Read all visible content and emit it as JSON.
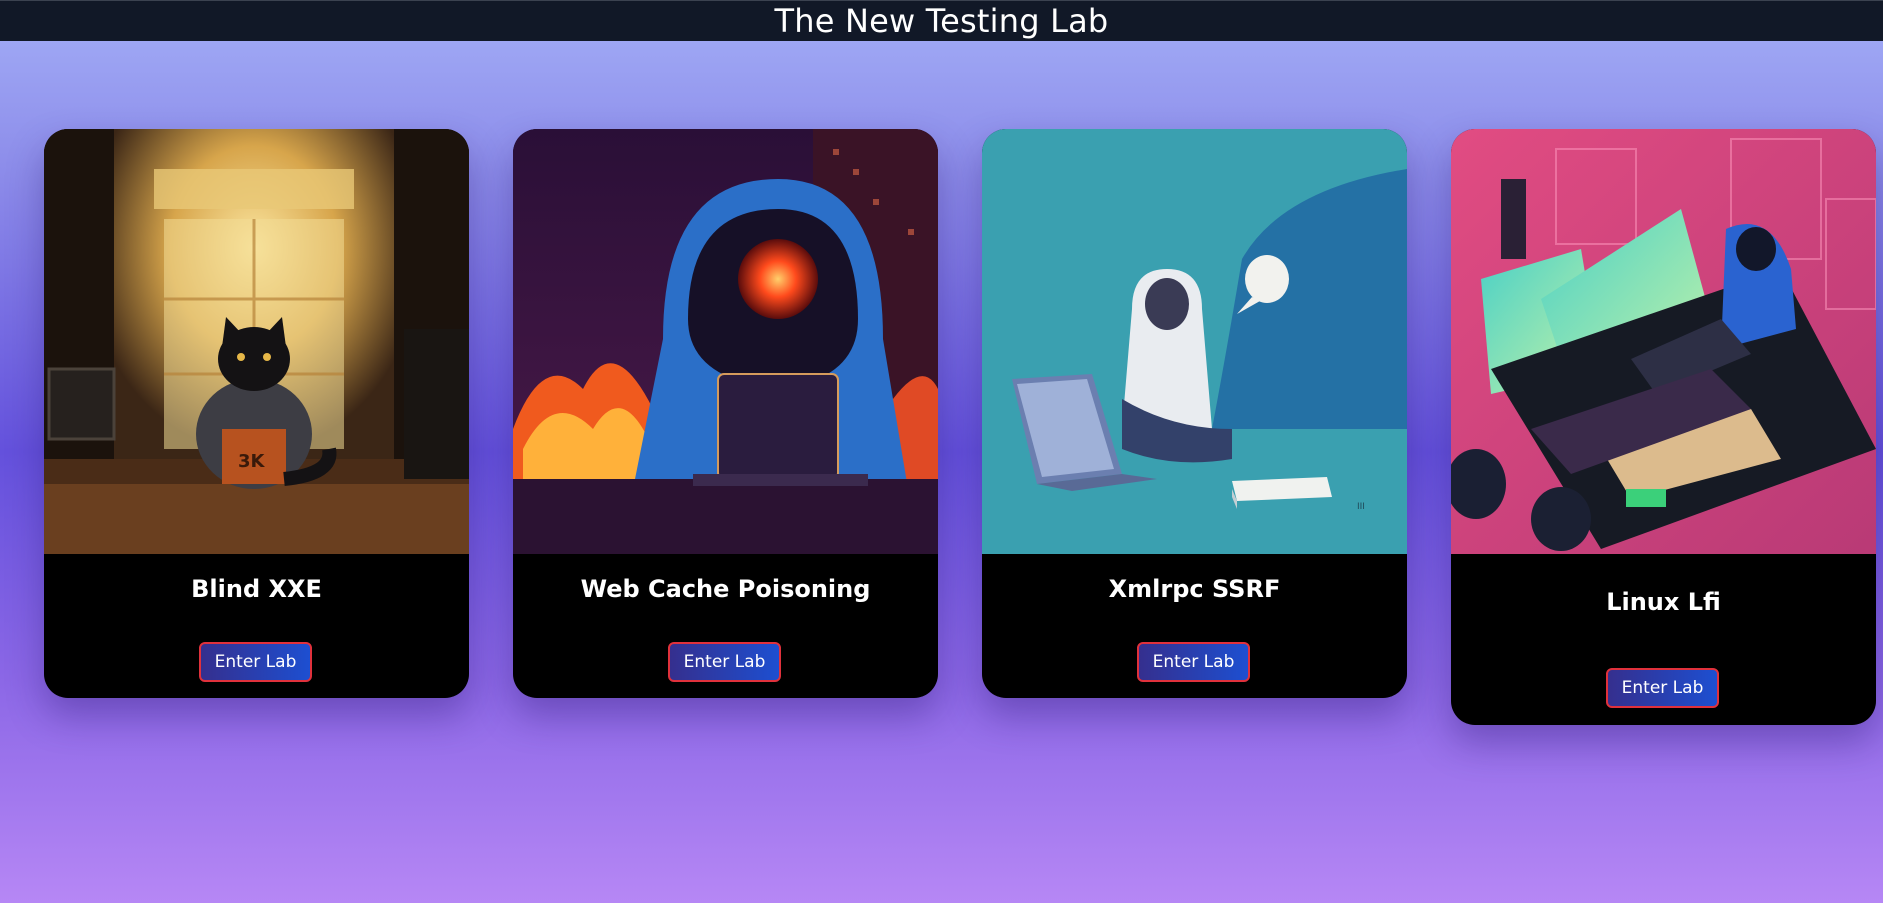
{
  "header": {
    "title": "The New Testing Lab"
  },
  "labs": [
    {
      "title": "Blind XXE",
      "button_label": "Enter Lab",
      "image_icon": "black-cat-laptop-illustration"
    },
    {
      "title": "Web Cache Poisoning",
      "button_label": "Enter Lab",
      "image_icon": "hooded-robot-hacker-fire-illustration"
    },
    {
      "title": "Xmlrpc SSRF",
      "button_label": "Enter Lab",
      "image_icon": "hoodie-person-laptop-illustration"
    },
    {
      "title": "Linux Lfi",
      "button_label": "Enter Lab",
      "image_icon": "hacker-neon-room-illustration"
    }
  ],
  "colors": {
    "header_bg": "#111827",
    "card_bg": "#000000",
    "button_start": "#352f8e",
    "button_end": "#1d4fd1",
    "button_border": "#e0313c"
  }
}
